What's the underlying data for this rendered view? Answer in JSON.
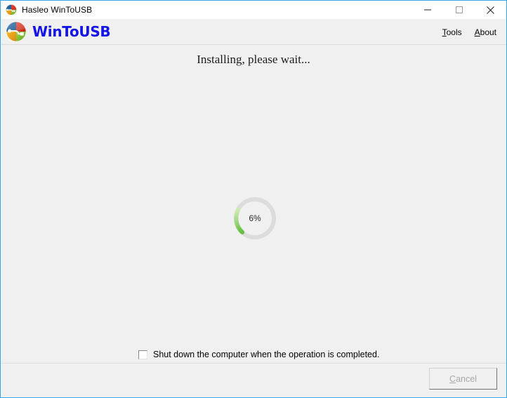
{
  "window": {
    "title": "Hasleo WinToUSB",
    "icon": "wintousb-logo-icon",
    "controls": {
      "minimize": "minimize-icon",
      "maximize": "maximize-icon",
      "close": "close-icon"
    },
    "border_color": "#38a5e8",
    "background_color": "#f0f0f0"
  },
  "header": {
    "logo": "wintousb-logo-icon",
    "brand": "WinToUSB",
    "brand_color": "#1414e6",
    "menu": [
      {
        "label": "Tools",
        "accel": "T",
        "rest": "ools"
      },
      {
        "label": "About",
        "accel": "A",
        "rest": "bout"
      }
    ]
  },
  "main": {
    "status_text": "Installing, please wait...",
    "progress": {
      "percent": 6,
      "label": "6%",
      "track_color": "#dcdcdc",
      "arc_color_start": "#bfe6a0",
      "arc_color_end": "#6cc14a"
    },
    "shutdown_option": {
      "label": "Shut down the computer when the operation is completed.",
      "checked": false
    }
  },
  "footer": {
    "cancel": {
      "label": "Cancel",
      "accel": "C",
      "rest": "ancel",
      "enabled": false
    }
  }
}
